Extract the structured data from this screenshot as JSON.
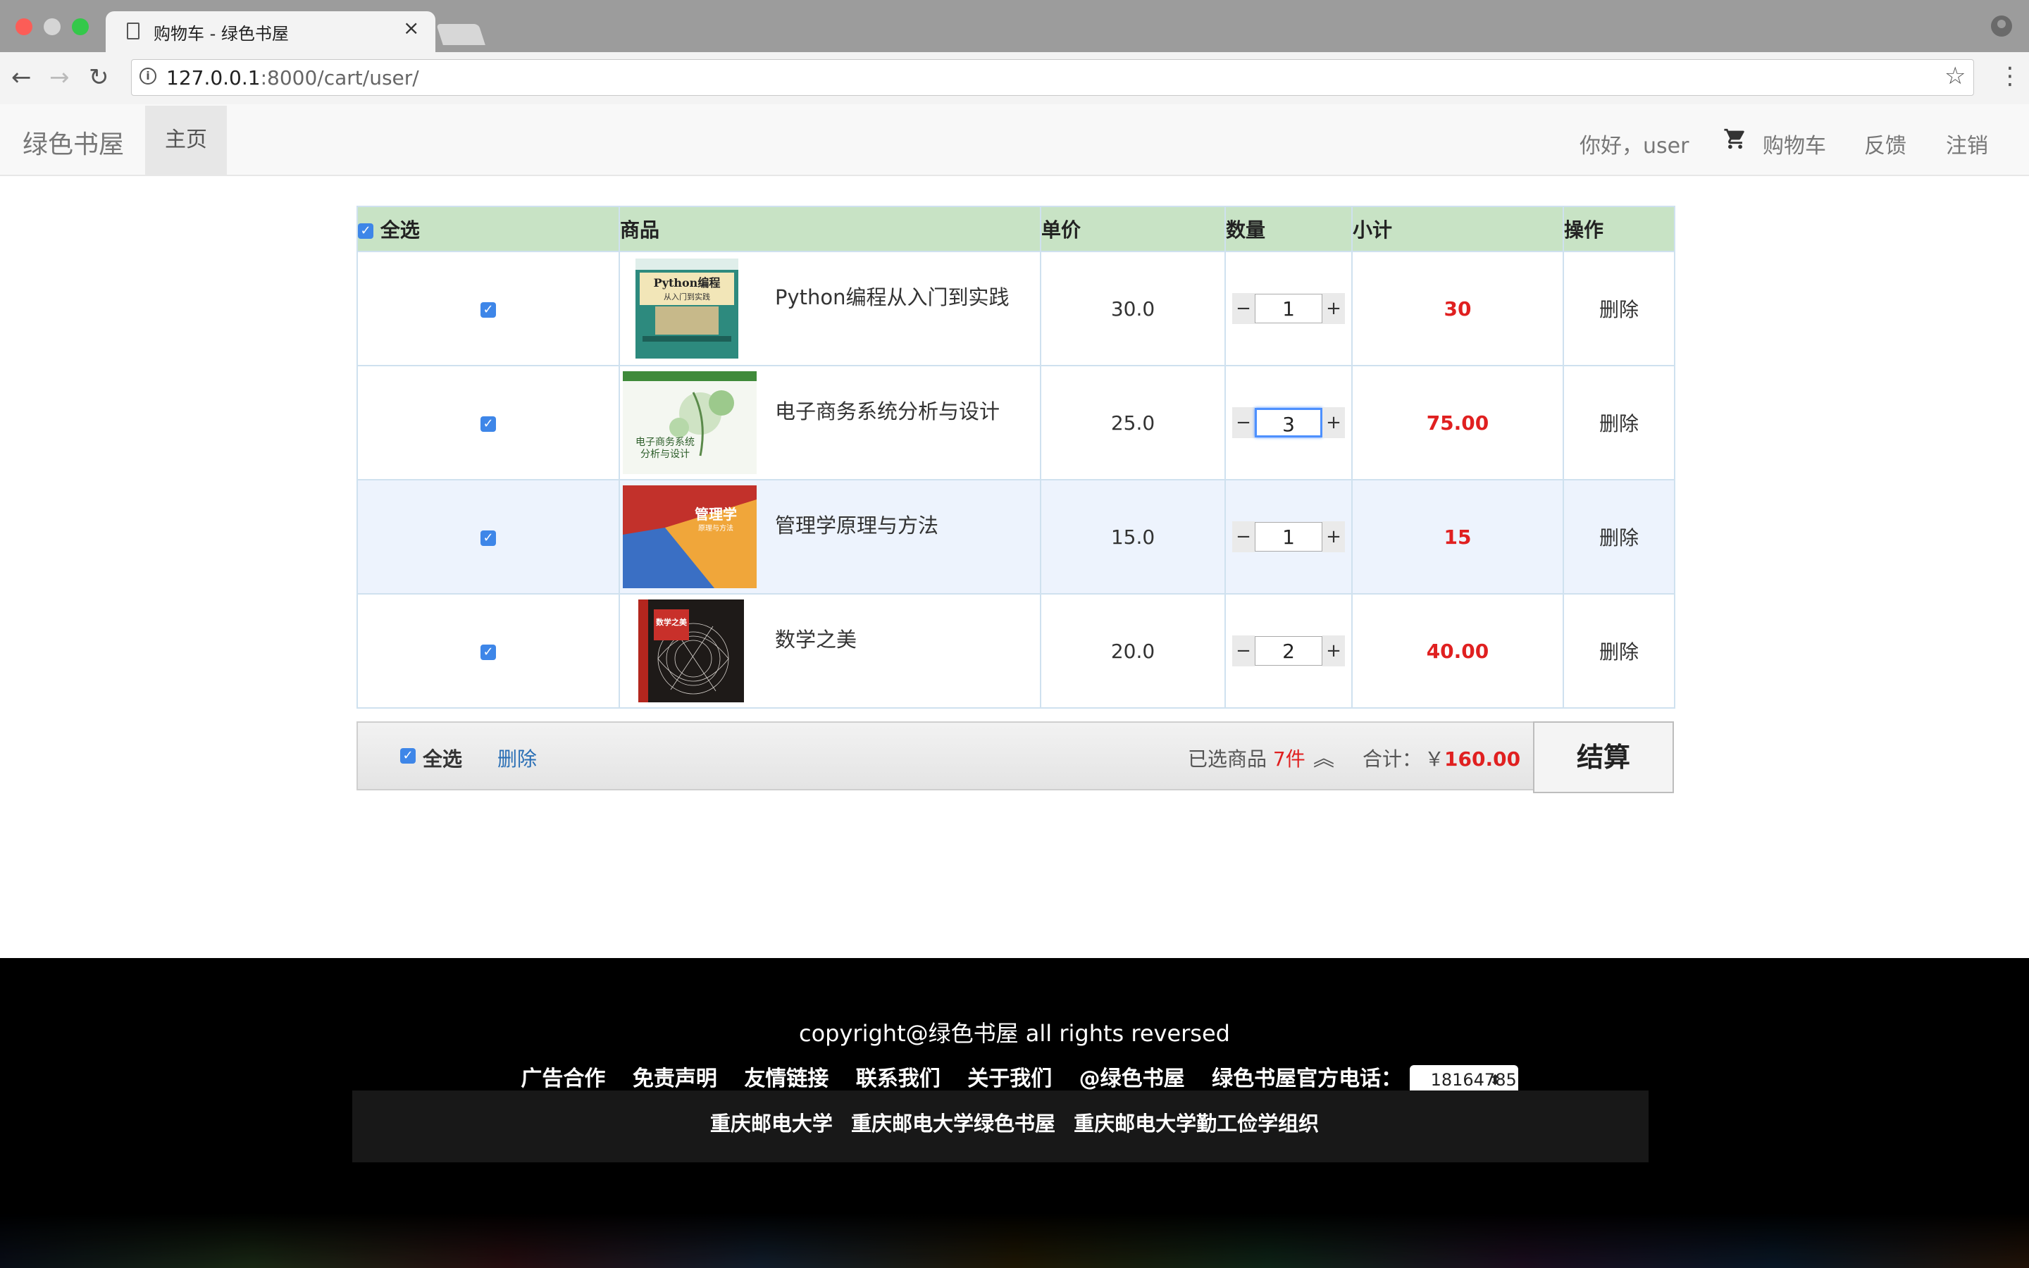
{
  "browser": {
    "tab_title": "购物车 - 绿色书屋",
    "url_host": "127.0.0.1",
    "url_path": ":8000/cart/user/"
  },
  "navbar": {
    "brand": "绿色书屋",
    "home": "主页",
    "greeting": "你好，user",
    "cart": "购物车",
    "feedback": "反馈",
    "logout": "注销"
  },
  "table": {
    "headers": {
      "select_all": "全选",
      "goods": "商品",
      "unit_price": "单价",
      "quantity": "数量",
      "subtotal": "小计",
      "action": "操作"
    },
    "rows": [
      {
        "name": "Python编程从入门到实践",
        "price": "30.0",
        "qty": "1",
        "subtotal": "30",
        "action": "删除",
        "checked": true,
        "cover_title": "Python编程",
        "cover_sub": "从入门到实践"
      },
      {
        "name": "电子商务系统分析与设计",
        "price": "25.0",
        "qty": "3",
        "subtotal": "75.00",
        "action": "删除",
        "checked": true,
        "cover_title": "电子商务系统",
        "cover_sub": "分析与设计"
      },
      {
        "name": "管理学原理与方法",
        "price": "15.0",
        "qty": "1",
        "subtotal": "15",
        "action": "删除",
        "checked": true,
        "cover_title": "管理学",
        "cover_sub": "原理与方法"
      },
      {
        "name": "数学之美",
        "price": "20.0",
        "qty": "2",
        "subtotal": "40.00",
        "action": "删除",
        "checked": true,
        "cover_title": "数学之美",
        "cover_sub": ""
      }
    ]
  },
  "summary": {
    "select_all": "全选",
    "delete": "删除",
    "selected_label": "已选商品",
    "selected_count": "7件",
    "total_label": "合计：",
    "currency": "￥",
    "total": "160.00",
    "checkout": "结算"
  },
  "footer": {
    "copyright": "copyright@绿色书屋 all rights reversed",
    "links": [
      "广告合作",
      "免责声明",
      "友情链接",
      "联系我们",
      "关于我们",
      "@绿色书屋"
    ],
    "phone_label": "绿色书屋官方电话：",
    "phone_value": "18164785",
    "links2": [
      "重庆邮电大学",
      "重庆邮电大学绿色书屋",
      "重庆邮电大学勤工俭学组织"
    ]
  },
  "colors": {
    "header_bg": "#c8e3c5",
    "accent_red": "#e02020",
    "link_blue": "#2a6fb5",
    "checkbox_blue": "#3e86e8"
  }
}
